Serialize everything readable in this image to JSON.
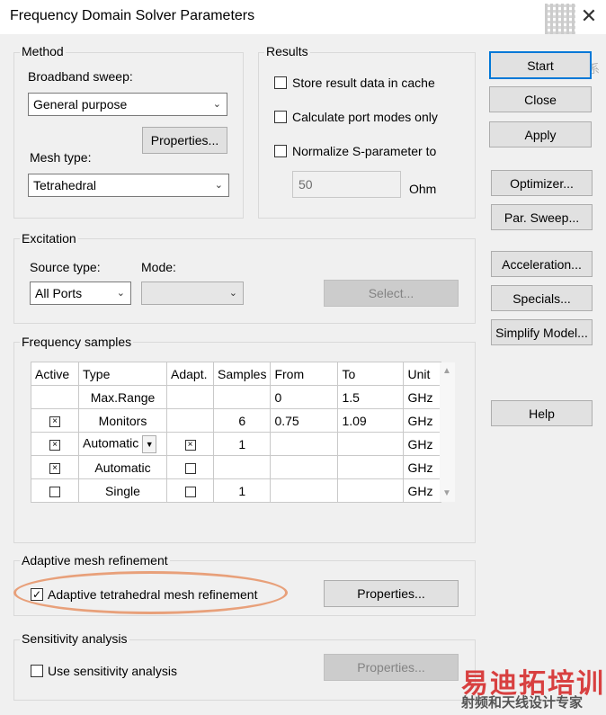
{
  "window": {
    "title": "Frequency Domain Solver Parameters",
    "close_glyph": "✕"
  },
  "method": {
    "group_label": "Method",
    "broadband_label": "Broadband sweep:",
    "broadband_value": "General purpose",
    "properties_label": "Properties...",
    "mesh_label": "Mesh type:",
    "mesh_value": "Tetrahedral"
  },
  "results": {
    "group_label": "Results",
    "store_cache": {
      "label": "Store result data in cache",
      "checked": false
    },
    "port_modes": {
      "label": "Calculate port modes only",
      "checked": false
    },
    "normalize": {
      "label": "Normalize S-parameter to",
      "checked": false
    },
    "impedance_value": "50",
    "impedance_unit": "Ohm"
  },
  "side_buttons": {
    "start": "Start",
    "close": "Close",
    "apply": "Apply",
    "optimizer": "Optimizer...",
    "par_sweep": "Par. Sweep...",
    "acceleration": "Acceleration...",
    "specials": "Specials...",
    "simplify": "Simplify Model...",
    "help": "Help"
  },
  "excitation": {
    "group_label": "Excitation",
    "source_label": "Source type:",
    "source_value": "All Ports",
    "mode_label": "Mode:",
    "mode_value": "",
    "select_label": "Select..."
  },
  "frequency_samples": {
    "group_label": "Frequency samples",
    "columns": [
      "Active",
      "Type",
      "Adapt.",
      "Samples",
      "From",
      "To",
      "Unit"
    ],
    "rows": [
      {
        "active": "",
        "type": "Max.Range",
        "adapt": "",
        "samples": "",
        "from": "0",
        "to": "1.5",
        "unit": "GHz"
      },
      {
        "active": "x",
        "type": "Monitors",
        "adapt": "",
        "samples": "6",
        "from": "0.75",
        "to": "1.09",
        "unit": "GHz"
      },
      {
        "active": "x",
        "type": "Automatic",
        "adapt": "x",
        "samples": "1",
        "from": "",
        "to": "",
        "unit": "GHz"
      },
      {
        "active": "x",
        "type": "Automatic",
        "adapt": "o",
        "samples": "",
        "from": "",
        "to": "",
        "unit": "GHz"
      },
      {
        "active": "o",
        "type": "Single",
        "adapt": "o",
        "samples": "1",
        "from": "",
        "to": "",
        "unit": "GHz"
      }
    ]
  },
  "adaptive": {
    "group_label": "Adaptive mesh refinement",
    "checkbox_label": "Adaptive tetrahedral mesh refinement",
    "checked": true,
    "properties_label": "Properties...",
    "highlight_color": "#e8a07a"
  },
  "sensitivity": {
    "group_label": "Sensitivity analysis",
    "checkbox_label": "Use sensitivity analysis",
    "checked": false,
    "properties_label": "Properties..."
  },
  "watermark": {
    "top_text": "微信联系",
    "bottom_title": "易迪拓培训",
    "bottom_sub": "射频和天线设计专家"
  }
}
